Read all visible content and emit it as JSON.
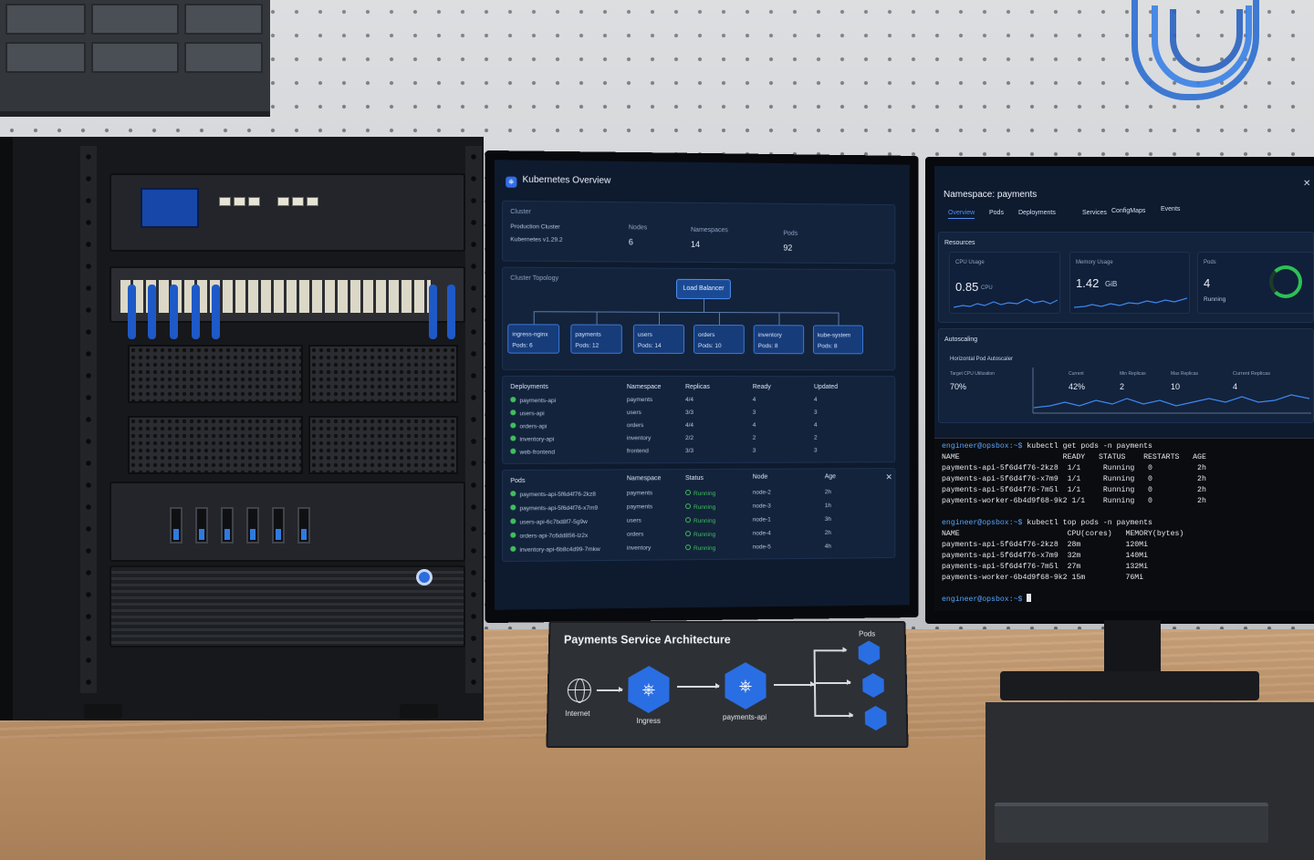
{
  "dashboard": {
    "title": "Kubernetes Overview",
    "cluster": {
      "label": "Cluster",
      "name": "Production Cluster",
      "version": "Kubernetes v1.29.2",
      "nodes_label": "Nodes",
      "nodes": "6",
      "namespaces_label": "Namespaces",
      "namespaces": "14",
      "pods_label": "Pods",
      "pods": "92"
    },
    "topology": {
      "label": "Cluster Topology",
      "root": "Load Balancer",
      "services": [
        {
          "name": "ingress-nginx",
          "pods": "Pods: 6"
        },
        {
          "name": "payments",
          "pods": "Pods: 12"
        },
        {
          "name": "users",
          "pods": "Pods: 14"
        },
        {
          "name": "orders",
          "pods": "Pods: 10"
        },
        {
          "name": "inventory",
          "pods": "Pods: 8"
        },
        {
          "name": "kube-system",
          "pods": "Pods: 8"
        }
      ]
    },
    "deployments": {
      "headers": [
        "Deployments",
        "Namespace",
        "Replicas",
        "Ready",
        "Updated"
      ],
      "rows": [
        [
          "payments-api",
          "payments",
          "4/4",
          "4",
          "4"
        ],
        [
          "users-api",
          "users",
          "3/3",
          "3",
          "3"
        ],
        [
          "orders-api",
          "orders",
          "4/4",
          "4",
          "4"
        ],
        [
          "inventory-api",
          "inventory",
          "2/2",
          "2",
          "2"
        ],
        [
          "web-frontend",
          "frontend",
          "3/3",
          "3",
          "3"
        ]
      ]
    },
    "pods": {
      "headers": [
        "Pods",
        "Namespace",
        "Status",
        "Node",
        "Age"
      ],
      "close_glyph": "✕",
      "rows": [
        [
          "payments-api-5f6d4f76-2kz8",
          "payments",
          "Running",
          "node-2",
          "2h"
        ],
        [
          "payments-api-5f6d4f76-x7m9",
          "payments",
          "Running",
          "node-3",
          "1h"
        ],
        [
          "users-api-6c7bd8f7-5g9w",
          "users",
          "Running",
          "node-1",
          "3h"
        ],
        [
          "orders-api-7c6dd856-lz2x",
          "orders",
          "Running",
          "node-4",
          "2h"
        ],
        [
          "inventory-api-6b8c4d99-7mkw",
          "inventory",
          "Running",
          "node-5",
          "4h"
        ]
      ]
    }
  },
  "namespace_panel": {
    "title": "Namespace: payments",
    "close_glyph": "✕",
    "tabs": [
      "Overview",
      "Pods",
      "Deployments",
      "Services",
      "ConfigMaps",
      "Events"
    ],
    "resources_label": "Resources",
    "cpu": {
      "label": "CPU Usage",
      "value": "0.85",
      "unit": "CPU"
    },
    "memory": {
      "label": "Memory Usage",
      "value": "1.42",
      "unit": "GiB"
    },
    "pods": {
      "label": "Pods",
      "value": "4",
      "status": "Running"
    },
    "autoscaling": {
      "label": "Autoscaling",
      "hpa_label": "Horizontal Pod Autoscaler",
      "target_label": "Target CPU Utilization",
      "target": "70%",
      "current_label": "Current",
      "current": "42%",
      "min_label": "Min Replicas",
      "min": "2",
      "max_label": "Max Replicas",
      "max": "10",
      "replicas_label": "Current Replicas",
      "replicas": "4"
    }
  },
  "terminal": {
    "lines": [
      {
        "prompt": "engineer@opsbox:~$",
        "cmd": " kubectl get pods -n payments"
      },
      {
        "text": "NAME                       READY   STATUS    RESTARTS   AGE"
      },
      {
        "text": "payments-api-5f6d4f76-2kz8  1/1     Running   0          2h"
      },
      {
        "text": "payments-api-5f6d4f76-x7m9  1/1     Running   0          2h"
      },
      {
        "text": "payments-api-5f6d4f76-7m5l  1/1     Running   0          2h"
      },
      {
        "text": "payments-worker-6b4d9f68-9k2 1/1    Running   0          2h"
      },
      {
        "prompt": "engineer@opsbox:~$",
        "cmd": " kubectl top pods -n payments"
      },
      {
        "text": "NAME                        CPU(cores)   MEMORY(bytes)"
      },
      {
        "text": "payments-api-5f6d4f76-2kz8  28m          120Mi"
      },
      {
        "text": "payments-api-5f6d4f76-x7m9  32m          140Mi"
      },
      {
        "text": "payments-api-5f6d4f76-7m5l  27m          132Mi"
      },
      {
        "text": "payments-worker-6b4d9f68-9k2 15m         76Mi"
      },
      {
        "prompt": "engineer@opsbox:~$",
        "cmd": " "
      }
    ]
  },
  "placard": {
    "title": "Payments Service Architecture",
    "internet": "Internet",
    "ingress": "Ingress",
    "service": "payments-api",
    "pods_label": "Pods"
  },
  "colors": {
    "accent": "#326ce5",
    "running": "#3fbf5a",
    "screen_bg": "#0e1a2e",
    "panel_bg": "#13233c"
  }
}
